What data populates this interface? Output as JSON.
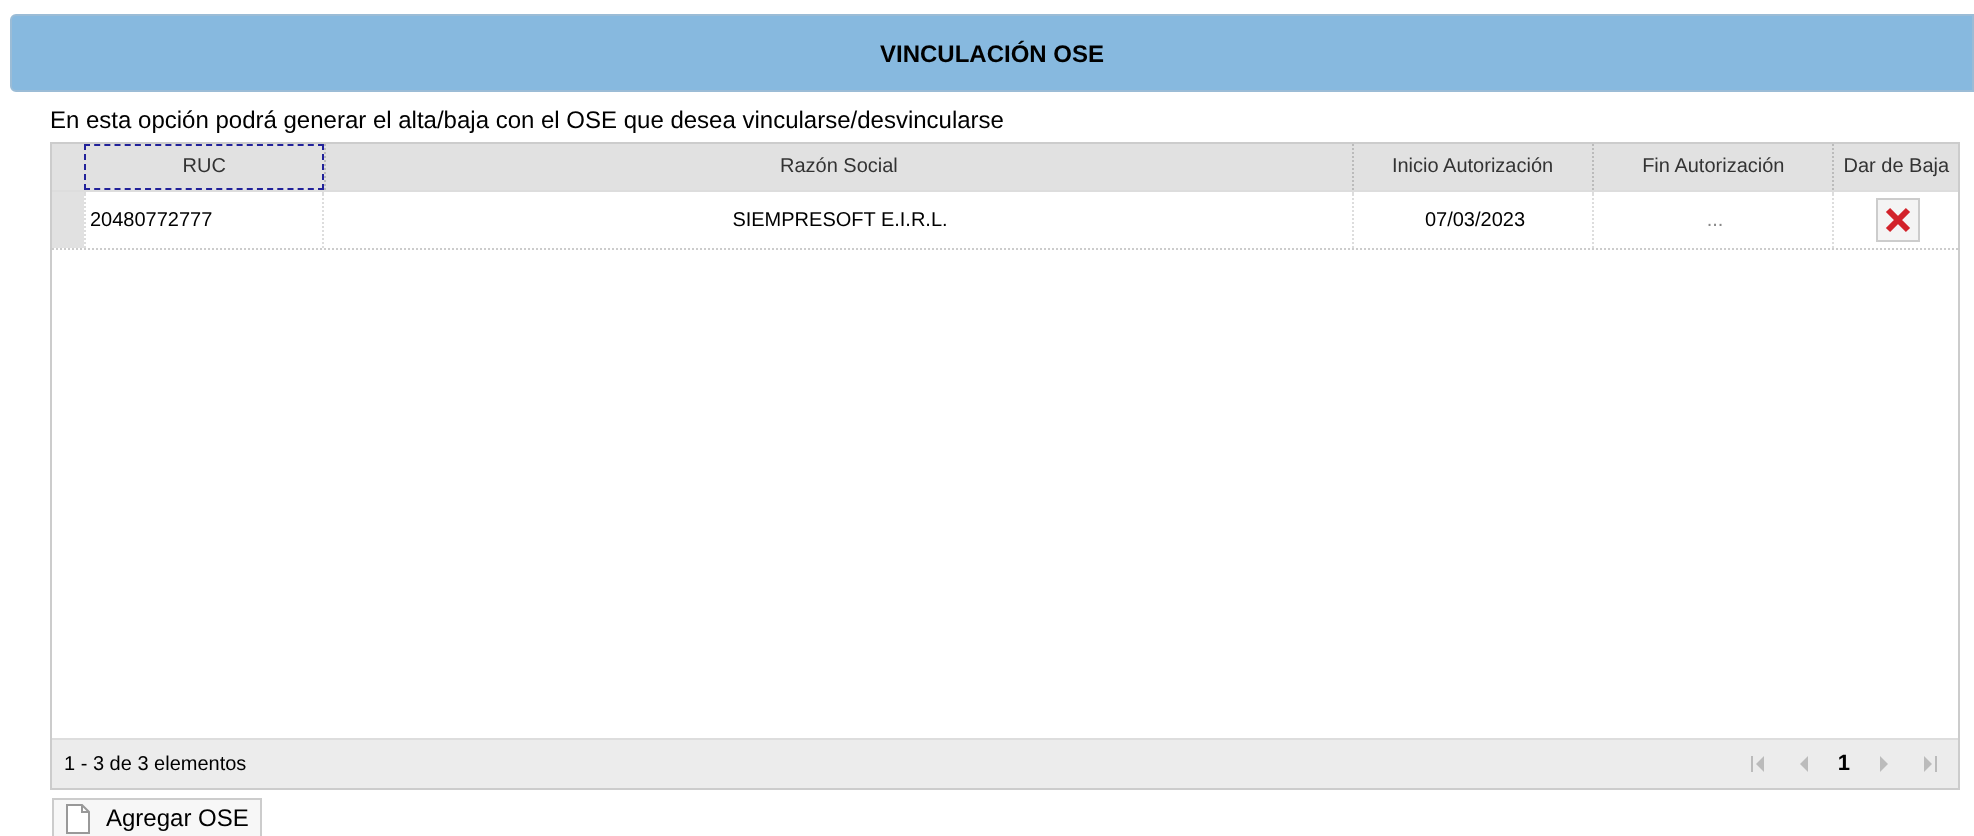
{
  "header": {
    "title": "VINCULACIÓN OSE"
  },
  "description": "En esta opción podrá generar el alta/baja con el OSE que desea vincularse/desvincularse",
  "table": {
    "columns": [
      "RUC",
      "Razón Social",
      "Inicio Autorización",
      "Fin Autorización",
      "Dar de Baja"
    ],
    "rows": [
      {
        "ruc": "20480772777",
        "razon_social": "SIEMPRESOFT E.I.R.L.",
        "inicio": "07/03/2023",
        "fin": "..."
      }
    ]
  },
  "pager": {
    "summary": "1 - 3 de 3 elementos",
    "pages": [
      {
        "label": "1",
        "selected": true
      }
    ]
  },
  "buttons": [
    {
      "label": "Agregar OSE"
    }
  ]
}
